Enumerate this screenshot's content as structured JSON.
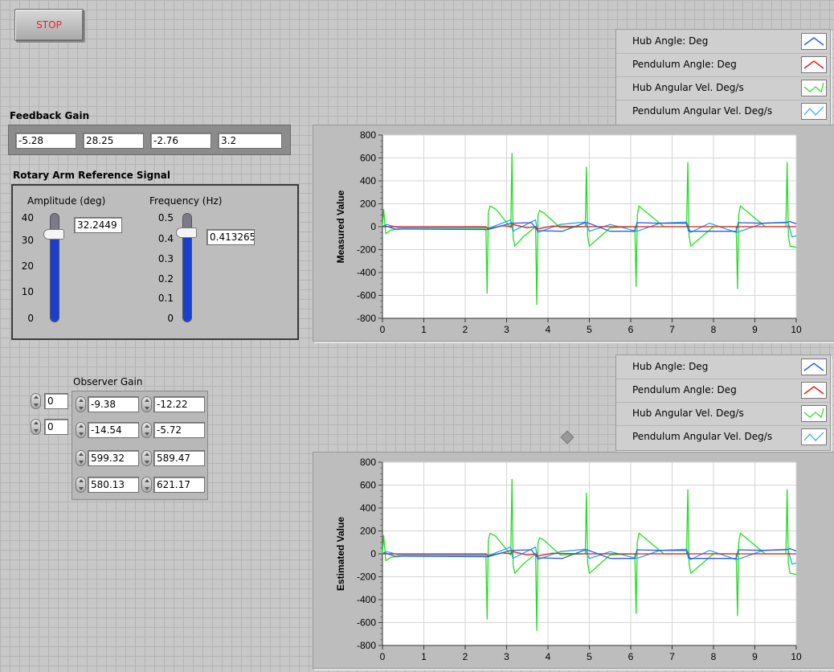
{
  "stop_button": {
    "label": "STOP",
    "color": "#e8202a"
  },
  "feedback_gain": {
    "label": "Feedback Gain",
    "values": [
      "-5.28",
      "28.25",
      "-2.76",
      "3.2"
    ]
  },
  "reference_signal": {
    "label": "Rotary Arm Reference Signal",
    "amplitude": {
      "label": "Amplitude (deg)",
      "value": "32.2449",
      "level": 32.2449,
      "max": 40,
      "ticks": [
        "40",
        "30",
        "20",
        "10",
        "0"
      ]
    },
    "frequency": {
      "label": "Frequency (Hz)",
      "value": "0.413265",
      "level": 0.413265,
      "max": 0.5,
      "ticks": [
        "0.5",
        "0.4",
        "0.3",
        "0.2",
        "0.1",
        "0"
      ]
    }
  },
  "observer": {
    "label": "Observer Gain",
    "index_values": [
      "0",
      "0"
    ],
    "gains": [
      [
        "-9.38",
        "-12.22"
      ],
      [
        "-14.54",
        "-5.72"
      ],
      [
        "599.32",
        "589.47"
      ],
      [
        "580.13",
        "621.17"
      ]
    ]
  },
  "legend_items": [
    {
      "label": "Hub Angle: Deg",
      "color": "#2b5ce6"
    },
    {
      "label": "Pendulum Angle: Deg",
      "color": "#e81c1c"
    },
    {
      "label": "Hub Angular Vel. Deg/s",
      "color": "#22dd22"
    },
    {
      "label": "Pendulum Angular Vel. Deg/s",
      "color": "#25a8ee"
    }
  ],
  "chart_data": [
    {
      "type": "line",
      "ylabel": "Measured Value",
      "xlabel": "",
      "xlim": [
        0,
        10
      ],
      "ylim": [
        -800,
        800
      ],
      "x_ticks": [
        "0",
        "1",
        "2",
        "3",
        "4",
        "5",
        "6",
        "7",
        "8",
        "9",
        "10"
      ],
      "y_ticks": [
        "800",
        "600",
        "400",
        "200",
        "0",
        "-200",
        "-400",
        "-600",
        "-800"
      ],
      "grid": true,
      "series": [
        {
          "name": "Hub Angle: Deg",
          "color": "#2b5ce6",
          "x": [
            0,
            0.05,
            0.3,
            2.5,
            2.55,
            3.1,
            3.15,
            3.6,
            3.75,
            4.35,
            4.9,
            4.95,
            5.5,
            6.1,
            6.15,
            6.7,
            7.35,
            7.4,
            7.9,
            8.55,
            8.6,
            9.2,
            9.75,
            9.85,
            10
          ],
          "y": [
            0,
            10,
            -20,
            -25,
            -25,
            30,
            30,
            35,
            -35,
            -40,
            35,
            35,
            -40,
            -40,
            35,
            30,
            30,
            -40,
            -40,
            -40,
            35,
            30,
            35,
            45,
            25
          ]
        },
        {
          "name": "Pendulum Angle: Deg",
          "color": "#e81c1c",
          "x": [
            0,
            0.3,
            2.5,
            2.55,
            2.9,
            3.1,
            3.15,
            3.5,
            3.7,
            3.75,
            4.1,
            4.9,
            5.5,
            6.15,
            6.8,
            7.4,
            8.0,
            8.6,
            9.2,
            9.8,
            10
          ],
          "y": [
            0,
            0,
            0,
            -20,
            10,
            0,
            20,
            -10,
            0,
            -20,
            5,
            0,
            0,
            0,
            0,
            0,
            0,
            0,
            0,
            0,
            0
          ]
        },
        {
          "name": "Hub Angular Vel. Deg/s",
          "color": "#22dd22",
          "x": [
            0,
            0.03,
            0.08,
            0.2,
            0.5,
            2.5,
            2.53,
            2.56,
            2.6,
            2.75,
            3.1,
            3.13,
            3.16,
            3.2,
            3.4,
            3.7,
            3.73,
            3.76,
            3.8,
            3.9,
            4.3,
            4.9,
            4.93,
            4.96,
            5.0,
            5.1,
            5.5,
            6.1,
            6.13,
            6.16,
            6.2,
            6.3,
            6.8,
            7.35,
            7.38,
            7.41,
            7.45,
            7.55,
            8.0,
            8.55,
            8.58,
            8.61,
            8.65,
            8.75,
            9.25,
            9.75,
            9.78,
            9.81,
            9.85,
            10
          ],
          "y": [
            0,
            150,
            -60,
            -30,
            -20,
            -20,
            -580,
            120,
            180,
            150,
            -10,
            640,
            -100,
            -170,
            -90,
            0,
            -680,
            100,
            140,
            120,
            -10,
            0,
            520,
            -80,
            -170,
            -140,
            -10,
            0,
            -520,
            100,
            180,
            150,
            0,
            0,
            560,
            -80,
            -170,
            -140,
            0,
            0,
            -540,
            100,
            180,
            150,
            0,
            0,
            560,
            -80,
            -170,
            -180
          ]
        },
        {
          "name": "Pendulum Angular Vel. Deg/s",
          "color": "#25a8ee",
          "x": [
            0,
            0.1,
            0.4,
            2.5,
            2.6,
            3.1,
            3.15,
            3.7,
            3.75,
            4.3,
            4.9,
            5.0,
            5.5,
            6.15,
            6.7,
            7.35,
            7.45,
            7.9,
            8.55,
            8.65,
            9.2,
            9.8,
            9.9,
            10
          ],
          "y": [
            0,
            20,
            -10,
            -10,
            -10,
            60,
            -40,
            60,
            -50,
            20,
            40,
            -40,
            20,
            -40,
            30,
            40,
            -50,
            30,
            -50,
            -40,
            30,
            40,
            -90,
            -80
          ]
        }
      ]
    },
    {
      "type": "line",
      "ylabel": "Estimated Value",
      "xlabel": "",
      "xlim": [
        0,
        10
      ],
      "ylim": [
        -800,
        800
      ],
      "x_ticks": [
        "0",
        "1",
        "2",
        "3",
        "4",
        "5",
        "6",
        "7",
        "8",
        "9",
        "10"
      ],
      "y_ticks": [
        "800",
        "600",
        "400",
        "200",
        "0",
        "-200",
        "-400",
        "-600",
        "-800"
      ],
      "grid": true,
      "series": [
        {
          "name": "Hub Angle: Deg",
          "color": "#2b5ce6",
          "x": [
            0,
            0.05,
            0.3,
            2.5,
            2.55,
            3.1,
            3.15,
            3.6,
            3.75,
            4.35,
            4.9,
            4.95,
            5.5,
            6.1,
            6.15,
            6.7,
            7.35,
            7.4,
            7.9,
            8.55,
            8.6,
            9.2,
            9.75,
            9.85,
            10
          ],
          "y": [
            0,
            10,
            -20,
            -25,
            -25,
            30,
            30,
            35,
            -35,
            -40,
            35,
            35,
            -40,
            -40,
            35,
            30,
            30,
            -40,
            -40,
            -40,
            35,
            30,
            35,
            45,
            25
          ]
        },
        {
          "name": "Pendulum Angle: Deg",
          "color": "#e81c1c",
          "x": [
            0,
            0.3,
            2.5,
            2.55,
            2.9,
            3.1,
            3.15,
            3.5,
            3.7,
            3.75,
            4.1,
            4.9,
            5.5,
            6.15,
            6.8,
            7.4,
            8.0,
            8.6,
            9.2,
            9.8,
            10
          ],
          "y": [
            0,
            0,
            0,
            -20,
            10,
            0,
            20,
            -10,
            0,
            -20,
            5,
            0,
            0,
            0,
            0,
            0,
            0,
            0,
            0,
            0,
            0
          ]
        },
        {
          "name": "Hub Angular Vel. Deg/s",
          "color": "#22dd22",
          "x": [
            0,
            0.03,
            0.08,
            0.2,
            0.5,
            2.5,
            2.53,
            2.56,
            2.6,
            2.75,
            3.1,
            3.13,
            3.16,
            3.2,
            3.4,
            3.7,
            3.73,
            3.76,
            3.8,
            3.9,
            4.3,
            4.9,
            4.93,
            4.96,
            5.0,
            5.1,
            5.5,
            6.1,
            6.13,
            6.16,
            6.2,
            6.3,
            6.8,
            7.35,
            7.38,
            7.41,
            7.45,
            7.55,
            8.0,
            8.55,
            8.58,
            8.61,
            8.65,
            8.75,
            9.25,
            9.75,
            9.78,
            9.81,
            9.85,
            10
          ],
          "y": [
            0,
            160,
            -60,
            -30,
            -20,
            -20,
            -570,
            120,
            180,
            150,
            -10,
            650,
            -100,
            -170,
            -90,
            0,
            -670,
            100,
            140,
            120,
            -10,
            0,
            530,
            -80,
            -170,
            -140,
            -10,
            0,
            -520,
            100,
            180,
            150,
            0,
            0,
            560,
            -80,
            -170,
            -140,
            0,
            0,
            -540,
            100,
            180,
            150,
            0,
            0,
            560,
            -80,
            -170,
            -180
          ]
        },
        {
          "name": "Pendulum Angular Vel. Deg/s",
          "color": "#25a8ee",
          "x": [
            0,
            0.1,
            0.4,
            2.5,
            2.6,
            3.1,
            3.15,
            3.7,
            3.75,
            4.3,
            4.9,
            5.0,
            5.5,
            6.15,
            6.7,
            7.35,
            7.45,
            7.9,
            8.55,
            8.65,
            9.2,
            9.8,
            9.9,
            10
          ],
          "y": [
            0,
            20,
            -10,
            -10,
            -10,
            60,
            -40,
            60,
            -50,
            20,
            40,
            -40,
            20,
            -40,
            30,
            40,
            -50,
            30,
            -50,
            -40,
            30,
            40,
            -90,
            -80
          ]
        }
      ]
    }
  ]
}
